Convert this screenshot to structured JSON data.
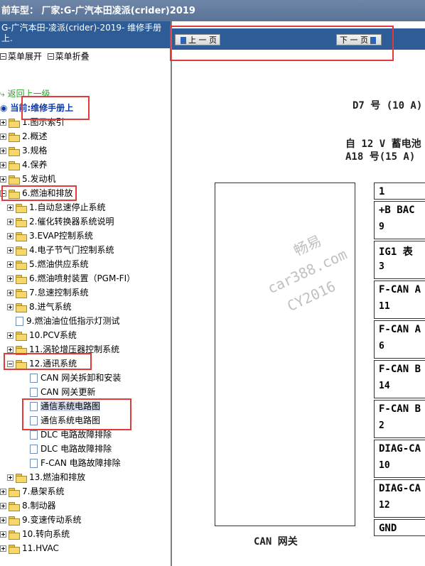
{
  "top": {
    "title": "前车型： 厂家:G-广汽本田凌派(crider)2019"
  },
  "left": {
    "header_line1": "G-广汽本田-凌派(crider)-2019- 维修手册",
    "header_line2": "上.",
    "expand_all": "菜单展开",
    "collapse_all": "菜单折叠",
    "back_label": "返回上一级",
    "current_label": "当前:维修手册上",
    "tree": [
      {
        "label": "1.图示索引",
        "level": 0,
        "type": "folder",
        "exp": "plus"
      },
      {
        "label": "2.概述",
        "level": 0,
        "type": "folder",
        "exp": "plus"
      },
      {
        "label": "3.规格",
        "level": 0,
        "type": "folder",
        "exp": "plus"
      },
      {
        "label": "4.保养",
        "level": 0,
        "type": "folder",
        "exp": "plus"
      },
      {
        "label": "5.发动机",
        "level": 0,
        "type": "folder",
        "exp": "plus"
      },
      {
        "label": "6.燃油和排放",
        "level": 0,
        "type": "folder",
        "exp": "minus"
      },
      {
        "label": "1.自动怠速停止系统",
        "level": 1,
        "type": "folder",
        "exp": "plus"
      },
      {
        "label": "2.催化转换器系统说明",
        "level": 1,
        "type": "folder",
        "exp": "plus"
      },
      {
        "label": "3.EVAP控制系统",
        "level": 1,
        "type": "folder",
        "exp": "plus"
      },
      {
        "label": "4.电子节气门控制系统",
        "level": 1,
        "type": "folder",
        "exp": "plus"
      },
      {
        "label": "5.燃油供应系统",
        "level": 1,
        "type": "folder",
        "exp": "plus"
      },
      {
        "label": "6.燃油喷射装置（PGM-FI）",
        "level": 1,
        "type": "folder",
        "exp": "plus"
      },
      {
        "label": "7.怠速控制系统",
        "level": 1,
        "type": "folder",
        "exp": "plus"
      },
      {
        "label": "8.进气系统",
        "level": 1,
        "type": "folder",
        "exp": "plus"
      },
      {
        "label": "9.燃油油位低指示灯测试",
        "level": 1,
        "type": "doc",
        "exp": "none"
      },
      {
        "label": "10.PCV系统",
        "level": 1,
        "type": "folder",
        "exp": "plus"
      },
      {
        "label": "11.涡轮增压器控制系统",
        "level": 1,
        "type": "folder",
        "exp": "plus"
      },
      {
        "label": "12.通讯系统",
        "level": 1,
        "type": "folder",
        "exp": "minus"
      },
      {
        "label": "CAN 网关拆卸和安装",
        "level": 2,
        "type": "doc",
        "exp": "none"
      },
      {
        "label": "CAN 网关更新",
        "level": 2,
        "type": "doc",
        "exp": "none"
      },
      {
        "label": "通信系统电路图",
        "level": 2,
        "type": "doc",
        "exp": "none",
        "selected": true
      },
      {
        "label": "通信系统电路图",
        "level": 2,
        "type": "doc",
        "exp": "none"
      },
      {
        "label": "DLC 电路故障排除",
        "level": 2,
        "type": "doc",
        "exp": "none"
      },
      {
        "label": "DLC 电路故障排除",
        "level": 2,
        "type": "doc",
        "exp": "none"
      },
      {
        "label": "F-CAN 电路故障排除",
        "level": 2,
        "type": "doc",
        "exp": "none"
      },
      {
        "label": "13.燃油和排放",
        "level": 1,
        "type": "folder",
        "exp": "plus"
      },
      {
        "label": "7.悬架系统",
        "level": 0,
        "type": "folder",
        "exp": "plus"
      },
      {
        "label": "8.制动器",
        "level": 0,
        "type": "folder",
        "exp": "plus"
      },
      {
        "label": "9.变速传动系统",
        "level": 0,
        "type": "folder",
        "exp": "plus"
      },
      {
        "label": "10.转向系统",
        "level": 0,
        "type": "folder",
        "exp": "plus"
      },
      {
        "label": "11.HVAC",
        "level": 0,
        "type": "folder",
        "exp": "plus"
      }
    ]
  },
  "nav": {
    "prev": "上 一 页",
    "next": "下 一 页"
  },
  "diagram": {
    "fuse_d7": "D7 号 (10 A)",
    "battery_line1": "自 12 V 蓄电池",
    "battery_line2": "A18 号(15 A)",
    "gateway_label": "CAN 网关",
    "pins": [
      {
        "name": "1",
        "num": ""
      },
      {
        "name": "+B BAC",
        "num": "9"
      },
      {
        "name": "IG1 表",
        "num": "3"
      },
      {
        "name": "F-CAN A",
        "num": "11"
      },
      {
        "name": "F-CAN A",
        "num": "6"
      },
      {
        "name": "F-CAN B",
        "num": "14"
      },
      {
        "name": "F-CAN B",
        "num": "2"
      },
      {
        "name": "DIAG-CA",
        "num": "10"
      },
      {
        "name": "DIAG-CA",
        "num": "12"
      },
      {
        "name": "GND",
        "num": ""
      }
    ],
    "watermark1": "畅易",
    "watermark2": "car388.com",
    "watermark3": "CY2016"
  }
}
